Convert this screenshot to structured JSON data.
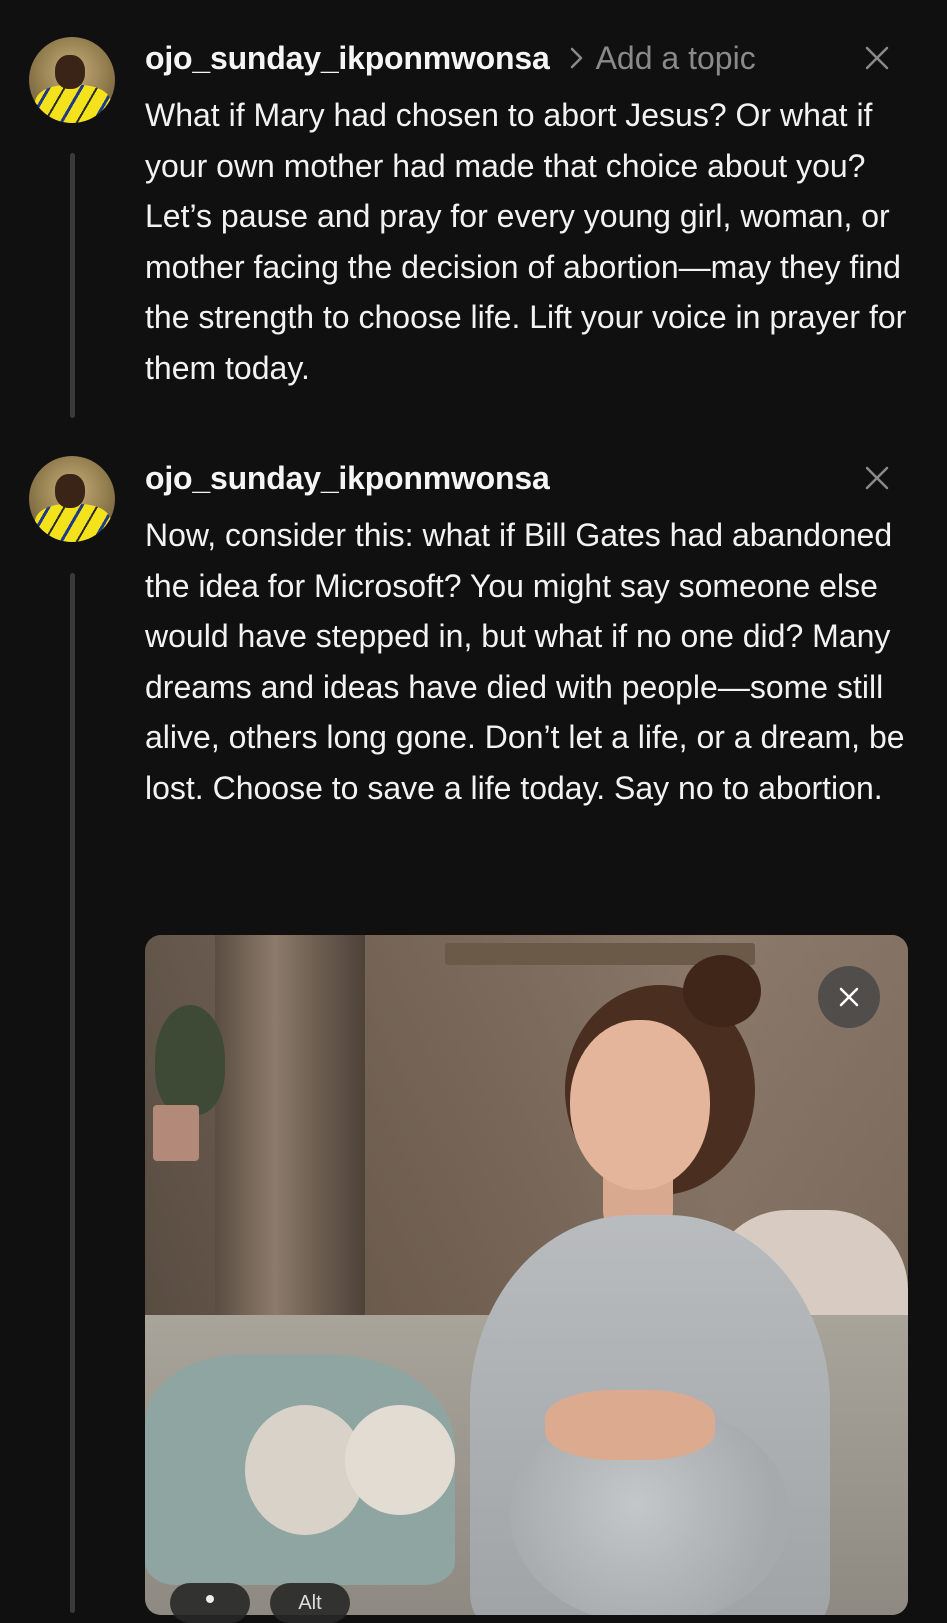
{
  "posts": [
    {
      "username": "ojo_sunday_ikponmwonsa",
      "topic_placeholder": "Add a topic",
      "text": "What if Mary had chosen to abort Jesus? Or what if your own mother had made that choice about you? Let’s pause and pray for every young girl, woman, or mother facing the decision of abortion—may they find the strength to choose life. Lift your voice in prayer for them today."
    },
    {
      "username": "ojo_sunday_ikponmwonsa",
      "text": "Now, consider this: what if Bill Gates had abandoned the idea for Microsoft? You might say someone else would have stepped in, but what if no one did? Many dreams and ideas have died with people—some still alive, others long gone. Don’t let a life, or a dream, be lost. Choose to save a life today. Say no to abortion."
    }
  ],
  "media": {
    "alt_chip_label": "Alt"
  },
  "colors": {
    "background": "#101010",
    "text_primary": "#f2f2f2",
    "text_muted": "#8a8a8a",
    "thread_line": "#3a3a3a"
  },
  "icons": {
    "close": "close-icon",
    "chevron": "chevron-right-icon",
    "tag": "person-tag-icon"
  }
}
